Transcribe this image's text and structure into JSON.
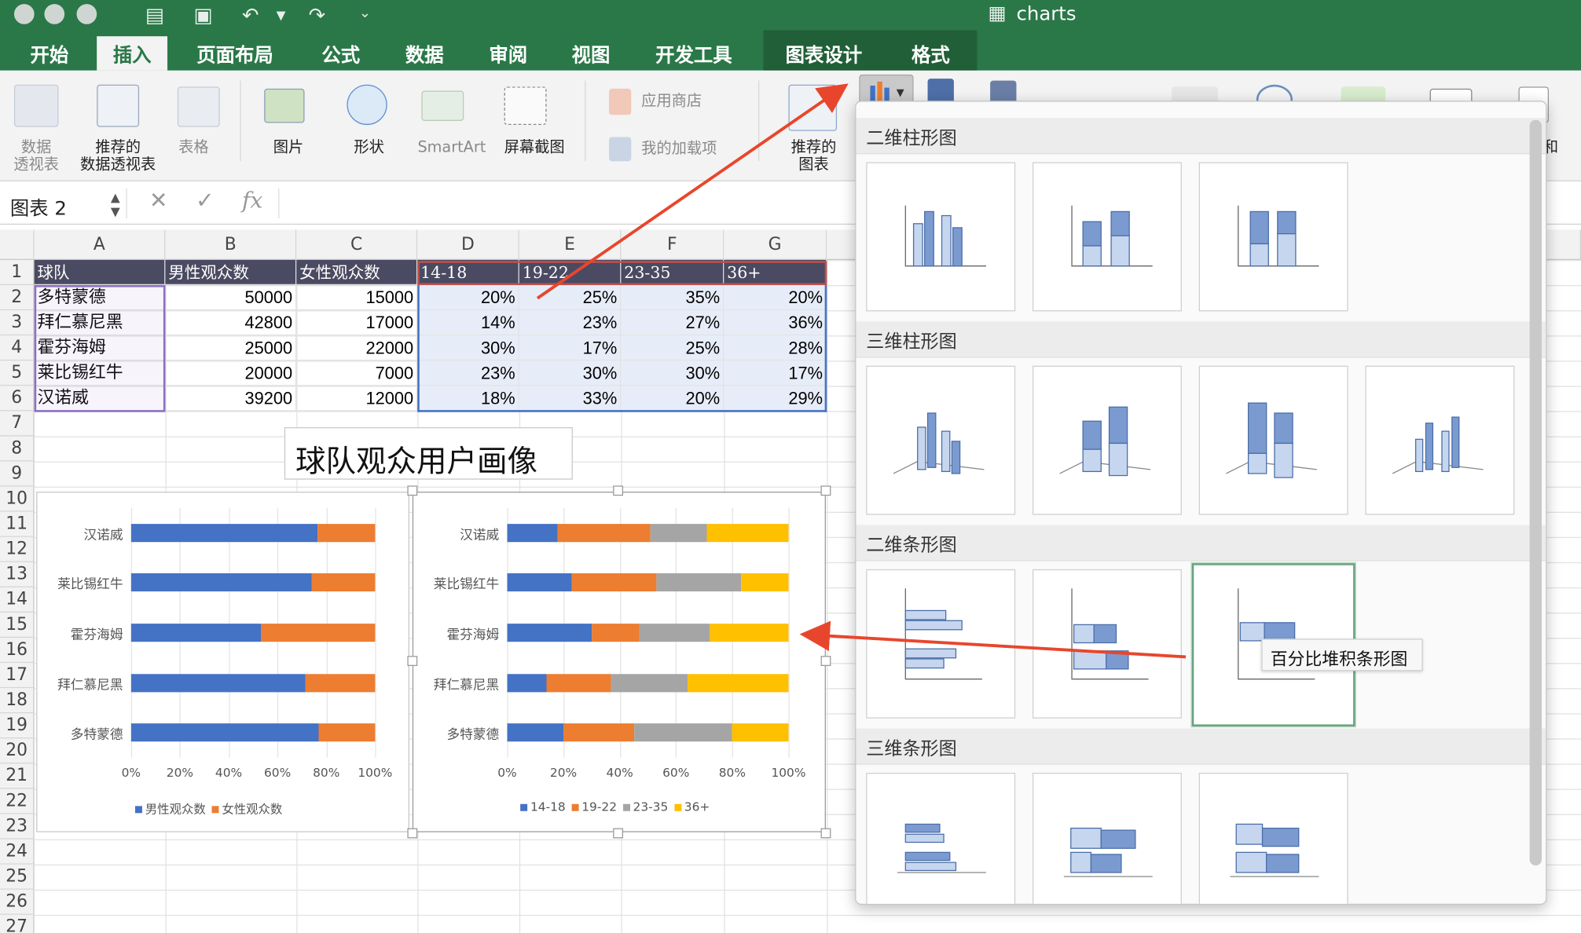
{
  "window": {
    "title": "charts"
  },
  "tabs": [
    "开始",
    "插入",
    "页面布局",
    "公式",
    "数据",
    "审阅",
    "视图",
    "开发工具",
    "图表设计",
    "格式"
  ],
  "ribbon": {
    "pivot": "数据\n透视表",
    "rec_pivot": "推荐的\n数据透视表",
    "table": "表格",
    "picture": "图片",
    "shapes": "形状",
    "smartart": "SmartArt",
    "screenshot": "屏幕截图",
    "store": "应用商店",
    "addins": "我的加载项",
    "rec_charts": "推荐的\n图表",
    "partial": "和"
  },
  "formula_bar": {
    "name_box": "图表 2",
    "fx": "fx",
    "formula": ""
  },
  "columns": [
    "A",
    "B",
    "C",
    "D",
    "E",
    "F",
    "G"
  ],
  "rows": [
    "1",
    "2",
    "3",
    "4",
    "5",
    "6",
    "7",
    "8",
    "9",
    "10",
    "11",
    "12",
    "13",
    "14",
    "15",
    "16",
    "17",
    "18",
    "19",
    "20",
    "21",
    "22",
    "23",
    "24",
    "25",
    "26",
    "27"
  ],
  "table": {
    "header": [
      "球队",
      "男性观众数",
      "女性观众数",
      "14-18",
      "19-22",
      "23-35",
      "36+"
    ],
    "rows": [
      [
        "多特蒙德",
        "50000",
        "15000",
        "20%",
        "25%",
        "35%",
        "20%"
      ],
      [
        "拜仁慕尼黑",
        "42800",
        "17000",
        "14%",
        "23%",
        "27%",
        "36%"
      ],
      [
        "霍芬海姆",
        "25000",
        "22000",
        "30%",
        "17%",
        "25%",
        "28%"
      ],
      [
        "莱比锡红牛",
        "20000",
        "7000",
        "23%",
        "30%",
        "30%",
        "17%"
      ],
      [
        "汉诺威",
        "39200",
        "12000",
        "18%",
        "33%",
        "20%",
        "29%"
      ]
    ]
  },
  "chart_title_box": "球队观众用户画像",
  "chart_data": [
    {
      "type": "bar",
      "stacking": "percent",
      "categories": [
        "汉诺威",
        "莱比锡红牛",
        "霍芬海姆",
        "拜仁慕尼黑",
        "多特蒙德"
      ],
      "series": [
        {
          "name": "男性观众数",
          "values": [
            39200,
            20000,
            25000,
            42800,
            50000
          ],
          "color": "#4472c4"
        },
        {
          "name": "女性观众数",
          "values": [
            12000,
            7000,
            22000,
            17000,
            15000
          ],
          "color": "#ed7d31"
        }
      ],
      "xticks": [
        "0%",
        "20%",
        "40%",
        "60%",
        "80%",
        "100%"
      ],
      "xlim": [
        0,
        100
      ],
      "legend": "bottom"
    },
    {
      "type": "bar",
      "stacking": "percent",
      "categories": [
        "汉诺威",
        "莱比锡红牛",
        "霍芬海姆",
        "拜仁慕尼黑",
        "多特蒙德"
      ],
      "series": [
        {
          "name": "14-18",
          "values": [
            18,
            23,
            30,
            14,
            20
          ],
          "color": "#4472c4"
        },
        {
          "name": "19-22",
          "values": [
            33,
            30,
            17,
            23,
            25
          ],
          "color": "#ed7d31"
        },
        {
          "name": "23-35",
          "values": [
            20,
            30,
            25,
            27,
            35
          ],
          "color": "#a5a5a5"
        },
        {
          "name": "36+",
          "values": [
            29,
            17,
            28,
            36,
            20
          ],
          "color": "#ffc000"
        }
      ],
      "xticks": [
        "0%",
        "20%",
        "40%",
        "60%",
        "80%",
        "100%"
      ],
      "xlim": [
        0,
        100
      ],
      "legend": "bottom"
    }
  ],
  "gallery": {
    "sections": [
      "二维柱形图",
      "三维柱形图",
      "二维条形图",
      "三维条形图"
    ],
    "tooltip": "百分比堆积条形图"
  }
}
